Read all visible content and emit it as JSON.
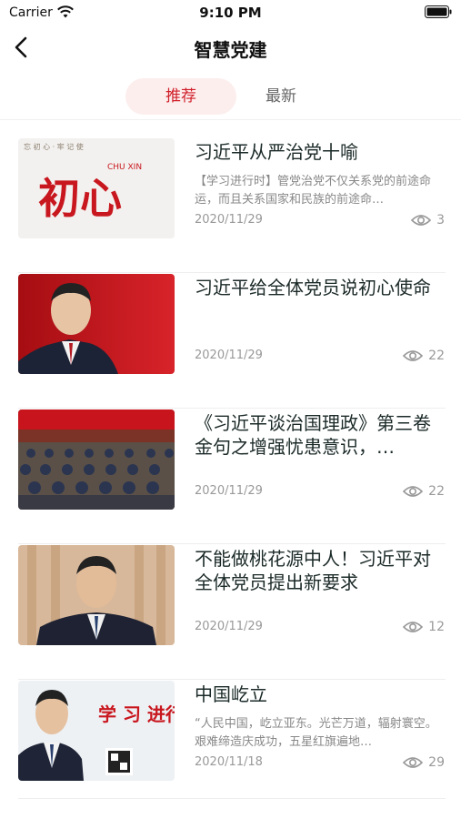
{
  "status_bar": {
    "carrier": "Carrier",
    "time": "9:10 PM"
  },
  "nav": {
    "title": "智慧党建"
  },
  "tabs": [
    {
      "label": "推荐",
      "active": true
    },
    {
      "label": "最新",
      "active": false
    }
  ],
  "articles": [
    {
      "title": "习近平从严治党十喻",
      "summary": "【学习进行时】管党治党不仅关系党的前途命运，而且关系国家和民族的前途命…",
      "date": "2020/11/29",
      "views": "3",
      "thumb_text": "初心",
      "thumb_small": "CHU XIN",
      "thumb_top": "忘 初 心 · 牢 记 使"
    },
    {
      "title": "习近平给全体党员说初心使命",
      "summary": "",
      "date": "2020/11/29",
      "views": "22"
    },
    {
      "title": "《习近平谈治国理政》第三卷金句之增强忧患意识，…",
      "summary": "",
      "date": "2020/11/29",
      "views": "22"
    },
    {
      "title": "不能做桃花源中人！习近平对全体党员提出新要求",
      "summary": "",
      "date": "2020/11/29",
      "views": "12"
    },
    {
      "title": "中国屹立",
      "summary": "“人民中国，屹立亚东。光芒万道，辐射寰空。艰难缔造庆成功，五星红旗遍地…",
      "date": "2020/11/18",
      "views": "29",
      "thumb_text": "学 习 进行"
    }
  ],
  "colors": {
    "accent": "#d0202a",
    "tab_active_bg": "#fdeeee",
    "title_text": "#1b2a28",
    "meta_text": "#999999"
  }
}
